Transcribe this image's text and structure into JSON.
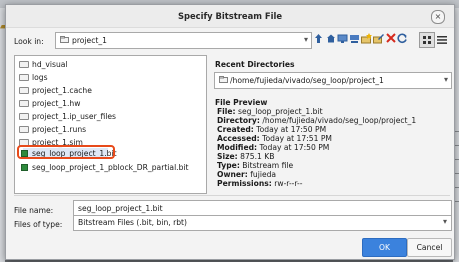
{
  "dialog": {
    "title": "Specify Bitstream File"
  },
  "look_in": {
    "label": "Look in:",
    "value": "project_1"
  },
  "toolbar_icons": [
    "up-folder-icon",
    "home-icon",
    "desktop-icon",
    "network-icon",
    "new-folder-icon",
    "edit-icon",
    "delete-icon",
    "refresh-icon",
    "list-view-icon",
    "details-view-icon"
  ],
  "file_list": {
    "items": [
      {
        "name": "hd_visual",
        "type": "folder"
      },
      {
        "name": "logs",
        "type": "folder"
      },
      {
        "name": "project_1.cache",
        "type": "folder"
      },
      {
        "name": "project_1.hw",
        "type": "folder"
      },
      {
        "name": "project_1.ip_user_files",
        "type": "folder"
      },
      {
        "name": "project_1.runs",
        "type": "folder"
      },
      {
        "name": "project_1.sim",
        "type": "folder"
      },
      {
        "name": "seg_loop_project_1.bit",
        "type": "bitstream",
        "selected": true
      },
      {
        "name": "seg_loop_project_1_pblock_DR_partial.bit",
        "type": "bitstream"
      }
    ]
  },
  "recent": {
    "label": "Recent Directories",
    "value": "/home/fujieda/vivado/seg_loop/project_1"
  },
  "preview": {
    "label": "File Preview",
    "rows": [
      {
        "k": "File:",
        "v": "seg_loop_project_1.bit"
      },
      {
        "k": "Directory:",
        "v": "/home/fujieda/vivado/seg_loop/project_1"
      },
      {
        "k": "Created:",
        "v": "Today at 17:50 PM"
      },
      {
        "k": "Accessed:",
        "v": "Today at 17:51 PM"
      },
      {
        "k": "Modified:",
        "v": "Today at 17:50 PM"
      },
      {
        "k": "Size:",
        "v": "875.1 KB"
      },
      {
        "k": "Type:",
        "v": "Bitstream file"
      },
      {
        "k": "Owner:",
        "v": "fujieda"
      },
      {
        "k": "Permissions:",
        "v": "rw-r--r--"
      }
    ]
  },
  "file_name": {
    "label": "File name:",
    "value": "seg_loop_project_1.bit"
  },
  "file_type": {
    "label": "Files of type:",
    "value": "Bitstream Files (.bit, bin, rbt)"
  },
  "buttons": {
    "ok": "OK",
    "cancel": "Cancel"
  },
  "colors": {
    "accent": "#3b82dd",
    "highlight": "#e84a1a",
    "bitstream": "#2d8a3c"
  }
}
